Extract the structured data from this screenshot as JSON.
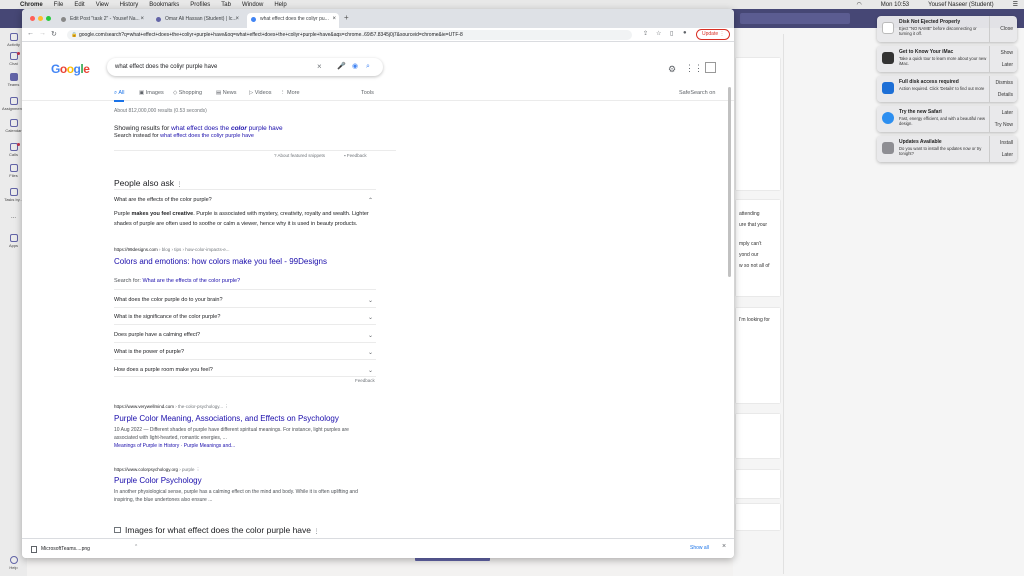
{
  "menubar": {
    "app": "Chrome",
    "items": [
      "File",
      "Edit",
      "View",
      "History",
      "Bookmarks",
      "Profiles",
      "Tab",
      "Window",
      "Help"
    ],
    "clock": "Mon 10:53",
    "user": "Yousef Naseer (Student)"
  },
  "teams": {
    "rail": [
      "Activity",
      "Chat",
      "Teams",
      "Assignments",
      "Calendar",
      "Calls",
      "Files",
      "Tasks by...",
      "...",
      "Apps",
      "Help"
    ],
    "snippets": [
      "attending",
      "ure that your",
      "mply can't",
      "yond our",
      "w so not all of",
      "I'm looking for"
    ]
  },
  "chrome": {
    "tabs": [
      {
        "title": "Edit Post \"task 2\" - Yousef Na..."
      },
      {
        "title": "Omar Ali Hassan (Student) | Ic..."
      },
      {
        "title": "what effect does the coliyr pu..."
      }
    ],
    "url": "google.com/search?q=what+effect+does+the+coliyr+purple+have&oq=what+effect+does+the+coliyr+purple+have&aqs=chrome..69i57.8345j0j7&sourceid=chrome&ie=UTF-8",
    "update_label": "Update"
  },
  "google": {
    "logo": "Google",
    "query": "what effect does the coliyr purple have",
    "tabs": [
      "All",
      "Images",
      "Shopping",
      "News",
      "Videos",
      "More"
    ],
    "tools": "Tools",
    "safesearch": "SafeSearch on",
    "stats": "About 812,000,000 results (0.53 seconds)",
    "showing_prefix": "Showing results for ",
    "showing_link_a": "what effect does the ",
    "showing_link_b": "color",
    "showing_link_c": " purple have",
    "instead_prefix": "Search instead for ",
    "instead_link": "what effect does the coliyr purple have",
    "featured": "About featured snippets",
    "feedback": "Feedback",
    "paa_title": "People also ask",
    "q1": "What are the effects of the color purple?",
    "ans_a": "Purple ",
    "ans_b": "makes you feel creative",
    "ans_c": ". Purple is associated with mystery, creativity, royalty and wealth. Lighter shades of purple are often used to soothe or calm a viewer, hence why it is used in beauty products.",
    "ans_cite_host": "https://99designs.com",
    "ans_cite_path": " › blog › tips › how-color-impacts-e...",
    "ans_title": "Colors and emotions: how colors make you feel - 99Designs",
    "search_for_prefix": "Search for: ",
    "search_for_link": "What are the effects of the color purple?",
    "questions": [
      "What does the color purple do to your brain?",
      "What is the significance of the color purple?",
      "Does purple have a calming effect?",
      "What is the power of purple?",
      "How does a purple room make you feel?"
    ],
    "feedback2": "Feedback",
    "r1_host": "https://www.verywellmind.com",
    "r1_path": " › the-color-psychology...",
    "r1_title": "Purple Color Meaning, Associations, and Effects on Psychology",
    "r1_snip": "10 Aug 2022 — Different shades of purple have different spiritual meanings. For instance, light purples are associated with light-hearted, romantic energies, ...",
    "r1_sub": "Meanings of Purple in History · Purple Meanings and...",
    "r2_host": "https://www.colorpsychology.org",
    "r2_path": " › purple",
    "r2_title": "Purple Color Psychology",
    "r2_snip": "In another physiological sense, purple has a calming effect on the mind and body. While it is often uplifting and inspiring, the blue undertones also ensure ...",
    "images_title": "Images for what effect does the color purple have"
  },
  "downloads": {
    "file": "MicrosoftTeams....png",
    "show_all": "Show all"
  },
  "notifications": [
    {
      "title": "Disk Not Ejected Properly",
      "body": "Eject \"NO NAME\" before disconnecting or turning it off.",
      "action1": "Close",
      "action2": ""
    },
    {
      "title": "Get to Know Your iMac",
      "body": "Take a quick tour to learn more about your new iMac.",
      "action1": "Show",
      "action2": "Later"
    },
    {
      "title": "Full disk access required",
      "body": "Action required. Click 'Details' to find out more",
      "action1": "Dismiss",
      "action2": "Details"
    },
    {
      "title": "Try the new Safari",
      "body": "Fast, energy efficient, and with a beautiful new design.",
      "action1": "Later",
      "action2": "Try Now"
    },
    {
      "title": "Updates Available",
      "body": "Do you want to install the updates now or try tonight?",
      "action1": "Install",
      "action2": "Later"
    }
  ],
  "colors": {
    "teams_purple": "#464775",
    "link": "#1a0dab",
    "accent": "#1a73e8"
  }
}
